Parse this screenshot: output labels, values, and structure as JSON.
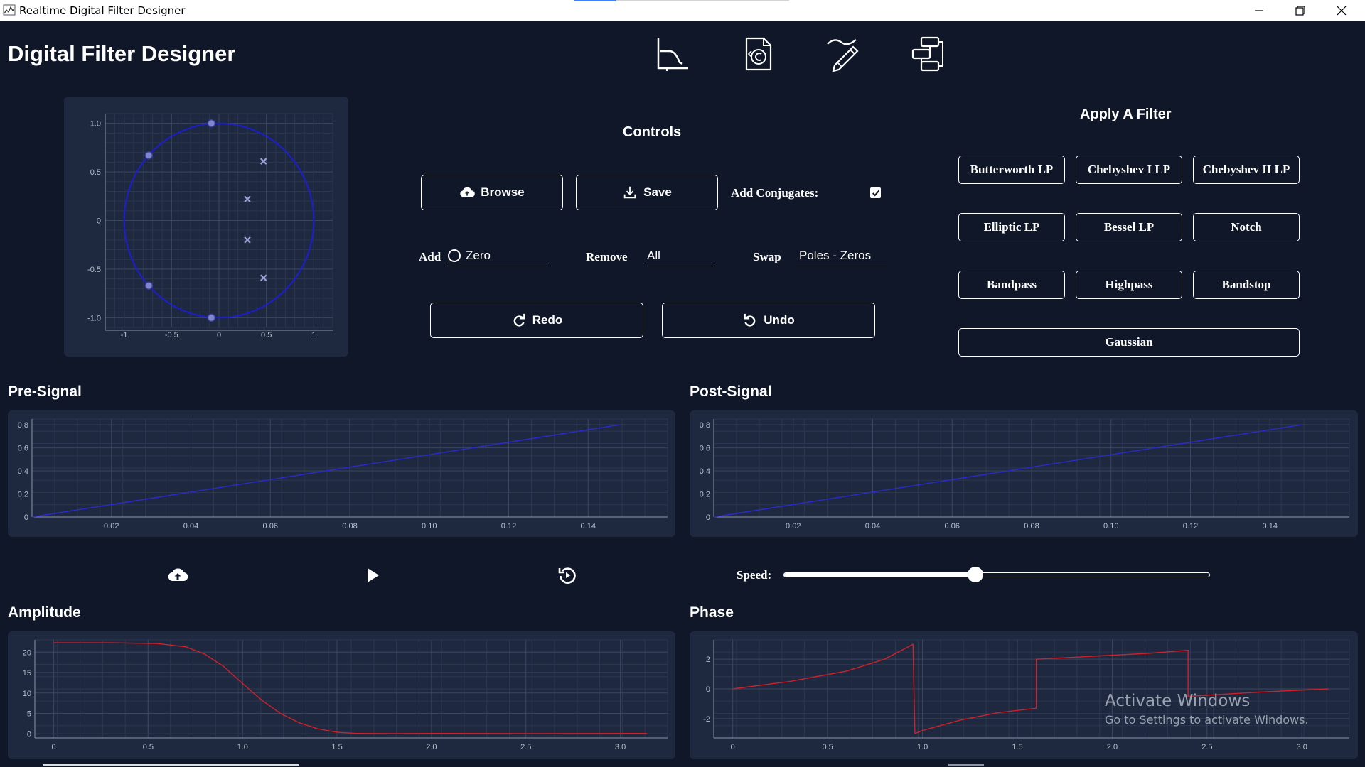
{
  "window": {
    "title": "Realtime Digital Filter Designer"
  },
  "app_title": "Digital Filter Designer",
  "nav_icons": [
    "frequency-response-icon",
    "code-file-icon",
    "draw-pencil-icon",
    "flowchart-icon"
  ],
  "controls": {
    "title": "Controls",
    "browse_label": "Browse",
    "save_label": "Save",
    "add_conjugates_label": "Add Conjugates:",
    "add_conjugates_checked": true,
    "add_label": "Add",
    "add_value": "Zero",
    "remove_label": "Remove",
    "remove_value": "All",
    "swap_label": "Swap",
    "swap_value": "Poles - Zeros",
    "redo_label": "Redo",
    "undo_label": "Undo"
  },
  "apply_filter": {
    "title": "Apply A Filter",
    "buttons": [
      "Butterworth LP",
      "Chebyshev I LP",
      "Chebyshev II LP",
      "Elliptic LP",
      "Bessel LP",
      "Notch",
      "Bandpass",
      "Highpass",
      "Bandstop",
      "Gaussian"
    ]
  },
  "sections": {
    "pre_signal": "Pre-Signal",
    "post_signal": "Post-Signal",
    "amplitude": "Amplitude",
    "phase": "Phase"
  },
  "playback": {
    "speed_label": "Speed:",
    "speed_fraction": 0.45
  },
  "watermark": {
    "line1": "Activate Windows",
    "line2": "Go to Settings to activate Windows."
  },
  "colors": {
    "background": "#0f1729",
    "panel": "#1e2940",
    "unit_circle": "#1d1dc9",
    "signal_line": "#2a2ad0",
    "response_line": "#d0202a"
  },
  "chart_data": [
    {
      "type": "scatter",
      "name": "z-plane",
      "xlim": [
        -1.2,
        1.2
      ],
      "ylim": [
        -1.1,
        1.1
      ],
      "x_ticks": [
        "-1",
        "-0.5",
        "0",
        "0.5",
        "1"
      ],
      "y_ticks": [
        "1.0",
        "0.5",
        "0",
        "-0.5",
        "-1.0"
      ],
      "grid": true,
      "unit_circle": true,
      "zeros": [
        [
          -0.08,
          1.0
        ],
        [
          -0.74,
          0.67
        ],
        [
          -0.74,
          -0.67
        ],
        [
          -0.08,
          -1.0
        ]
      ],
      "poles": [
        [
          0.47,
          0.61
        ],
        [
          0.3,
          0.22
        ],
        [
          0.3,
          -0.2
        ],
        [
          0.47,
          -0.59
        ]
      ]
    },
    {
      "type": "line",
      "name": "pre-signal",
      "xlim": [
        0,
        0.16
      ],
      "ylim": [
        0,
        0.85
      ],
      "x_ticks": [
        "0.02",
        "0.04",
        "0.06",
        "0.08",
        "0.10",
        "0.12",
        "0.14"
      ],
      "y_ticks": [
        "0",
        "0.2",
        "0.4",
        "0.6",
        "0.8"
      ],
      "x": [
        0,
        0.148
      ],
      "y": [
        0,
        0.8
      ]
    },
    {
      "type": "line",
      "name": "post-signal",
      "xlim": [
        0,
        0.16
      ],
      "ylim": [
        0,
        0.85
      ],
      "x_ticks": [
        "0.02",
        "0.04",
        "0.06",
        "0.08",
        "0.10",
        "0.12",
        "0.14"
      ],
      "y_ticks": [
        "0",
        "0.2",
        "0.4",
        "0.6",
        "0.8"
      ],
      "x": [
        0,
        0.148
      ],
      "y": [
        0,
        0.8
      ]
    },
    {
      "type": "line",
      "name": "amplitude",
      "xlim": [
        -0.1,
        3.25
      ],
      "ylim": [
        -1,
        23
      ],
      "x_ticks": [
        "0",
        "0.5",
        "1.0",
        "1.5",
        "2.0",
        "2.5",
        "3.0"
      ],
      "y_ticks": [
        "0",
        "5",
        "10",
        "15",
        "20"
      ],
      "x": [
        0,
        0.3,
        0.55,
        0.7,
        0.8,
        0.9,
        1.0,
        1.1,
        1.2,
        1.3,
        1.4,
        1.5,
        1.6,
        1.8,
        2.0,
        2.5,
        3.14
      ],
      "y": [
        22.3,
        22.3,
        22.1,
        21.3,
        19.5,
        16.5,
        12.3,
        8.3,
        5.0,
        2.7,
        1.2,
        0.4,
        0.1,
        0.05,
        0.1,
        0.05,
        0.1
      ]
    },
    {
      "type": "line",
      "name": "phase",
      "xlim": [
        -0.1,
        3.25
      ],
      "ylim": [
        -3.3,
        3.3
      ],
      "x_ticks": [
        "0",
        "0.5",
        "1.0",
        "1.5",
        "2.0",
        "2.5",
        "3.0"
      ],
      "y_ticks": [
        "-2",
        "0",
        "2"
      ],
      "x": [
        0,
        0.3,
        0.6,
        0.8,
        0.95,
        0.96,
        1.0,
        1.2,
        1.4,
        1.6,
        1.6,
        1.9,
        2.2,
        2.4,
        2.4,
        2.6,
        2.8,
        3.14
      ],
      "y": [
        0,
        0.5,
        1.2,
        2.0,
        3.0,
        -3.0,
        -2.8,
        -2.1,
        -1.6,
        -1.3,
        2.0,
        2.2,
        2.4,
        2.6,
        -0.5,
        -0.35,
        -0.2,
        0.0
      ]
    }
  ]
}
